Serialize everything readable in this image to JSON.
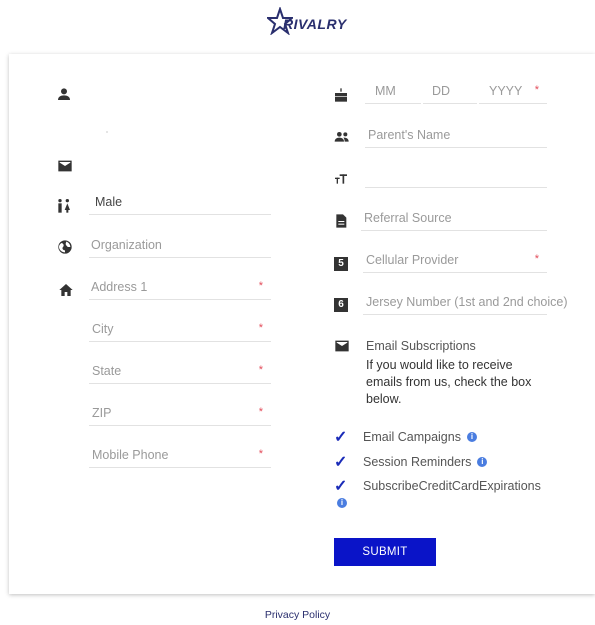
{
  "brand": {
    "logo_text": "RIVALRY"
  },
  "left": {
    "gender_value": "Male",
    "organization_placeholder": "Organization",
    "address1_placeholder": "Address 1",
    "city_placeholder": "City",
    "state_placeholder": "State",
    "zip_placeholder": "ZIP",
    "mobile_placeholder": "Mobile Phone",
    "required_mark": "*"
  },
  "right": {
    "dob": {
      "mm": "MM",
      "dd": "DD",
      "yyyy": "YYYY"
    },
    "parent_placeholder": "Parent's Name",
    "referral_placeholder": "Referral Source",
    "cellular_placeholder": "Cellular Provider",
    "jersey_placeholder": "Jersey Number (1st and 2nd choice)",
    "icon5_text": "5",
    "icon6_text": "6",
    "email_subscriptions": {
      "title": "Email Subscriptions",
      "description": "If you would like to receive emails from us, check the box below.",
      "options": [
        {
          "label": "Email Campaigns",
          "checked": true
        },
        {
          "label": "Session Reminders",
          "checked": true
        },
        {
          "label": "SubscribeCreditCardExpirations",
          "checked": true
        }
      ]
    }
  },
  "actions": {
    "submit_label": "SUBMIT"
  },
  "footer": {
    "privacy_label": "Privacy Policy"
  },
  "colors": {
    "accent": "#0a14c8",
    "required": "#e34b5a",
    "info": "#4a7de0",
    "brand": "#2a2f6e"
  },
  "glyphs": {
    "checkmark": "✓",
    "info": "i"
  }
}
